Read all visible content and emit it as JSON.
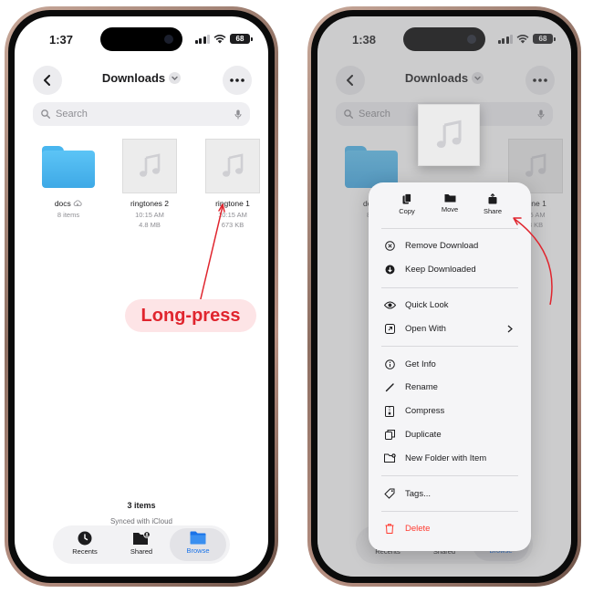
{
  "left": {
    "status_time": "1:37",
    "battery": "68",
    "title": "Downloads",
    "search_placeholder": "Search",
    "files": [
      {
        "name": "docs",
        "meta1": "8 items",
        "meta2": "",
        "kind": "folder"
      },
      {
        "name": "ringtones 2",
        "meta1": "10:15 AM",
        "meta2": "4.8 MB",
        "kind": "audio"
      },
      {
        "name": "ringtone 1",
        "meta1": "10:15 AM",
        "meta2": "673 KB",
        "kind": "audio"
      }
    ],
    "count": "3 items",
    "sync": "Synced with iCloud",
    "callout": "Long-press"
  },
  "right": {
    "status_time": "1:38",
    "battery": "68",
    "title": "Downloads",
    "search_placeholder": "Search",
    "partial_labels": {
      "docs": "docs",
      "docs_meta": "8 it",
      "ringtone": "tone 1",
      "ringtone_meta1": "15 AM",
      "ringtone_meta2": "3 KB"
    },
    "menu_top": [
      {
        "label": "Copy",
        "icon": "copy-icon"
      },
      {
        "label": "Move",
        "icon": "folder-icon"
      },
      {
        "label": "Share",
        "icon": "share-icon"
      }
    ],
    "menu_groups": [
      [
        {
          "label": "Remove Download",
          "icon": "remove-download-icon"
        },
        {
          "label": "Keep Downloaded",
          "icon": "keep-downloaded-icon"
        }
      ],
      [
        {
          "label": "Quick Look",
          "icon": "eye-icon"
        },
        {
          "label": "Open With",
          "icon": "open-with-icon"
        }
      ],
      [
        {
          "label": "Get Info",
          "icon": "info-icon"
        },
        {
          "label": "Rename",
          "icon": "pencil-icon"
        },
        {
          "label": "Compress",
          "icon": "archive-icon"
        },
        {
          "label": "Duplicate",
          "icon": "duplicate-icon"
        },
        {
          "label": "New Folder with Item",
          "icon": "new-folder-icon"
        }
      ],
      [
        {
          "label": "Tags...",
          "icon": "tag-icon"
        }
      ],
      [
        {
          "label": "Delete",
          "icon": "trash-icon"
        }
      ]
    ]
  },
  "tabs": [
    {
      "label": "Recents",
      "icon": "clock-icon"
    },
    {
      "label": "Shared",
      "icon": "shared-folder-icon"
    },
    {
      "label": "Browse",
      "icon": "browse-folder-icon"
    }
  ],
  "colors": {
    "accent": "#1a73e8",
    "callout_text": "#e0252e",
    "callout_bg": "#fde4e6",
    "folder": "#4cb8f1",
    "delete": "#ff3b30",
    "arrow": "#e0252e"
  }
}
